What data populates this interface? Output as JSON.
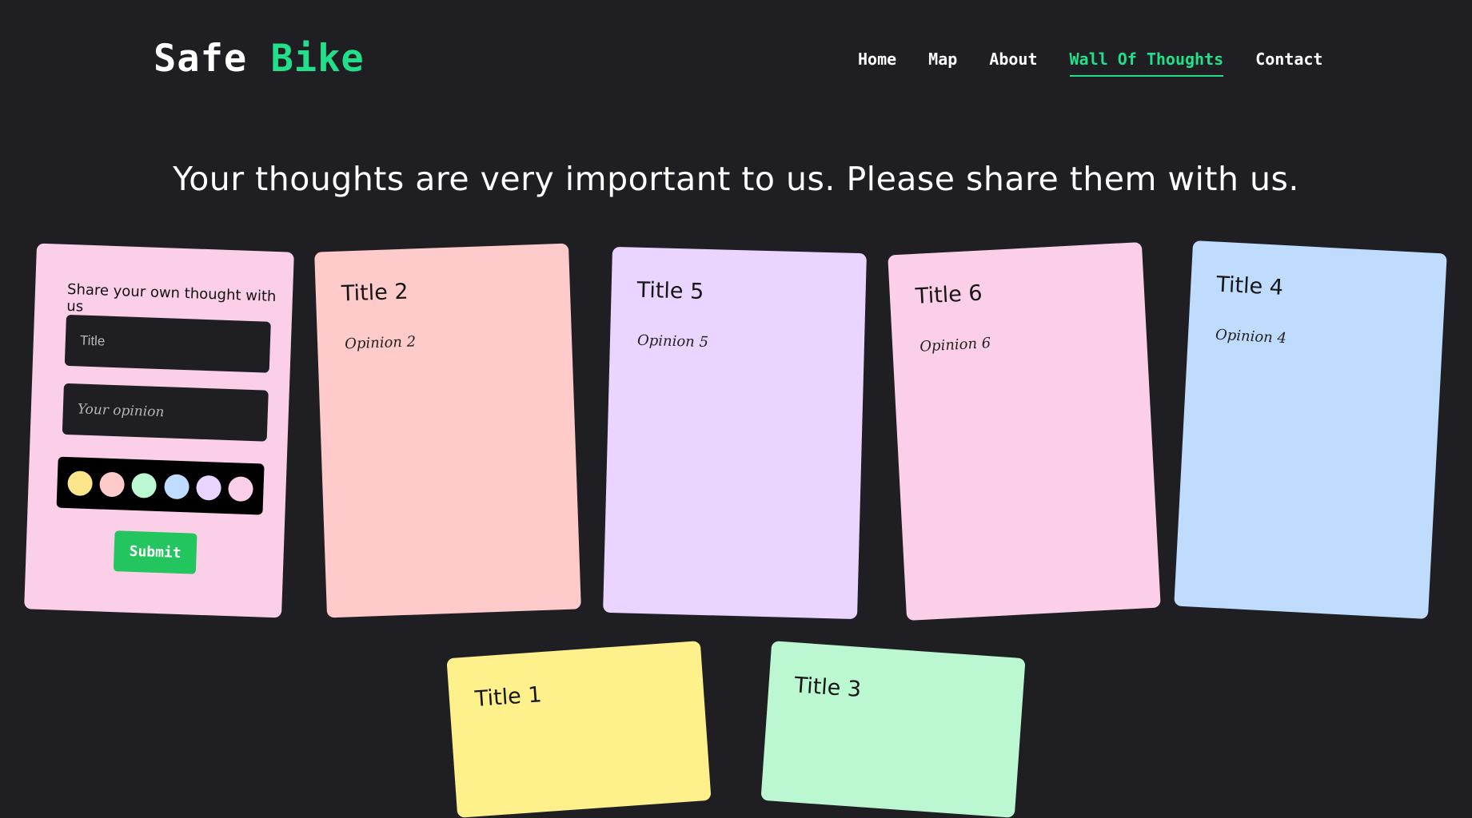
{
  "brand": {
    "part1": "Safe",
    "part2": "Bike"
  },
  "nav": {
    "home": "Home",
    "map": "Map",
    "about": "About",
    "wall": "Wall Of Thoughts",
    "contact": "Contact",
    "active": "Wall Of Thoughts"
  },
  "headline": "Your thoughts are very important to us. Please share them with us.",
  "form": {
    "heading": "Share your own thought with us",
    "title_placeholder": "Title",
    "opinion_placeholder": "Your opinion",
    "colors": [
      "#fde68a",
      "#fecaca",
      "#bbf7d0",
      "#bfdbfe",
      "#e9d5ff",
      "#fbcfe8"
    ],
    "submit_label": "Submit",
    "card_color": "#fbcfe8"
  },
  "thoughts": [
    {
      "title": "Title 2",
      "opinion": "Opinion 2",
      "color": "#fecaca"
    },
    {
      "title": "Title 5",
      "opinion": "Opinion 5",
      "color": "#e9d5ff"
    },
    {
      "title": "Title 6",
      "opinion": "Opinion 6",
      "color": "#fbcfe8"
    },
    {
      "title": "Title 4",
      "opinion": "Opinion 4",
      "color": "#bfdbfe"
    },
    {
      "title": "Title 1",
      "opinion": "",
      "color": "#fef08a"
    },
    {
      "title": "Title 3",
      "opinion": "",
      "color": "#bbf7d0"
    }
  ],
  "colors": {
    "background": "#1e1e23",
    "accent": "#22e08a",
    "button": "#22c55e"
  }
}
